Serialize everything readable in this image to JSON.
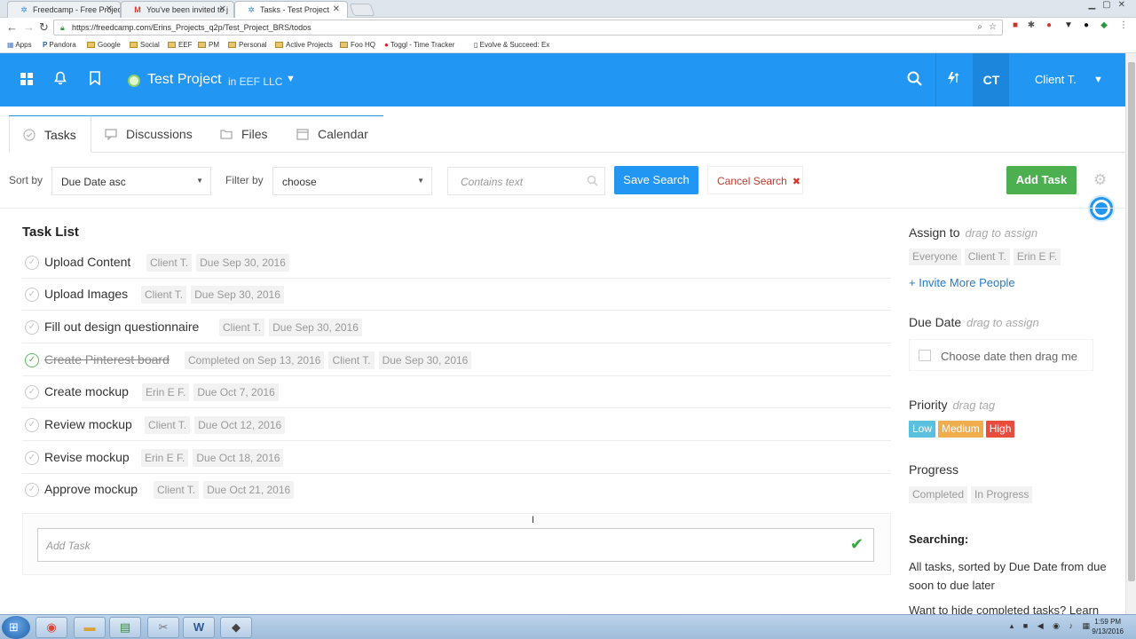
{
  "browser": {
    "tabs": [
      {
        "label": "Freedcamp - Free Projec",
        "icon": "freedcamp-icon"
      },
      {
        "label": "You've been invited to j",
        "icon": "gmail-icon"
      },
      {
        "label": "Tasks - Test Project",
        "icon": "freedcamp-icon"
      }
    ],
    "url": "https://freedcamp.com/Erins_Projects_q2p/Test_Project_BRS/todos",
    "bookmarks": [
      "Apps",
      "Pandora",
      "Google",
      "Social",
      "EEF",
      "PM",
      "Personal",
      "Active Projects",
      "Foo HQ",
      "Toggl - Time Tracker",
      "Evolve & Succeed: Ex"
    ]
  },
  "header": {
    "project_title": "Test Project",
    "project_org": "in EEF LLC",
    "avatar_initials": "CT",
    "user_name": "Client T.",
    "accent": "#2196f3"
  },
  "tabs": [
    {
      "label": "Tasks",
      "icon": "check-circle-icon"
    },
    {
      "label": "Discussions",
      "icon": "chat-icon"
    },
    {
      "label": "Files",
      "icon": "folder-icon"
    },
    {
      "label": "Calendar",
      "icon": "calendar-icon"
    }
  ],
  "toolbar": {
    "sort_label": "Sort by",
    "sort_value": "Due Date asc",
    "filter_label": "Filter by",
    "filter_value": "choose",
    "search_placeholder": "Contains text",
    "save_search": "Save Search",
    "cancel_search": "Cancel Search",
    "add_task": "Add Task"
  },
  "task_list": {
    "title": "Task List",
    "tasks": [
      {
        "title": "Upload Content",
        "tags": [
          "Client T.",
          "Due Sep 30, 2016"
        ],
        "done": false
      },
      {
        "title": "Upload Images",
        "tags": [
          "Client T.",
          "Due Sep 30, 2016"
        ],
        "done": false
      },
      {
        "title": "Fill out design questionnaire",
        "tags": [
          "Client T.",
          "Due Sep 30, 2016"
        ],
        "done": false
      },
      {
        "title": "Create Pinterest board",
        "tags": [
          "Completed on Sep 13, 2016",
          "Client T.",
          "Due Sep 30, 2016"
        ],
        "done": true
      },
      {
        "title": "Create mockup",
        "tags": [
          "Erin E F.",
          "Due Oct 7, 2016"
        ],
        "done": false
      },
      {
        "title": "Review mockup",
        "tags": [
          "Client T.",
          "Due Oct 12, 2016"
        ],
        "done": false
      },
      {
        "title": "Revise mockup",
        "tags": [
          "Erin E F.",
          "Due Oct 18, 2016"
        ],
        "done": false
      },
      {
        "title": "Approve mockup",
        "tags": [
          "Client T.",
          "Due Oct 21, 2016"
        ],
        "done": false
      }
    ],
    "add_placeholder": "Add Task"
  },
  "sidebar": {
    "assign_title": "Assign to",
    "assign_hint": "drag to assign",
    "assign_tags": [
      "Everyone",
      "Client T.",
      "Erin E F."
    ],
    "invite": "+ Invite More People",
    "due_title": "Due Date",
    "due_hint": "drag to assign",
    "date_placeholder": "Choose date then drag me",
    "priority_title": "Priority",
    "priority_hint": "drag tag",
    "priority_low": "Low",
    "priority_medium": "Medium",
    "priority_high": "High",
    "priority_colors": {
      "low": "#5bc0de",
      "medium": "#f0ad4e",
      "high": "#e74c3c"
    },
    "progress_title": "Progress",
    "progress_tags": [
      "Completed",
      "In Progress"
    ],
    "searching_title": "Searching:",
    "searching_text": "All tasks, sorted by Due Date from due soon to due later",
    "hide_text": "Want to hide completed tasks? Learn"
  },
  "os": {
    "time": "1:59 PM",
    "date": "9/13/2016"
  }
}
